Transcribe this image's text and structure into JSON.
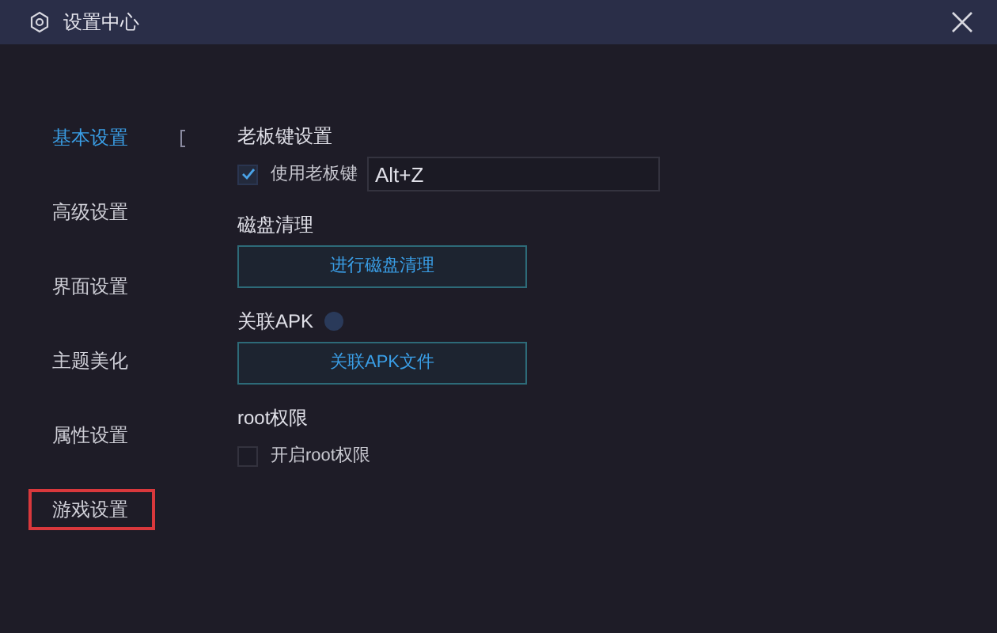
{
  "window": {
    "title": "设置中心"
  },
  "sidebar": {
    "items": [
      {
        "label": "基本设置",
        "selected": true,
        "highlighted": false
      },
      {
        "label": "高级设置",
        "selected": false,
        "highlighted": false
      },
      {
        "label": "界面设置",
        "selected": false,
        "highlighted": false
      },
      {
        "label": "主题美化",
        "selected": false,
        "highlighted": false
      },
      {
        "label": "属性设置",
        "selected": false,
        "highlighted": false
      },
      {
        "label": "游戏设置",
        "selected": false,
        "highlighted": true
      }
    ]
  },
  "sections": [
    {
      "title": "老板键设置",
      "kind": "checkbox-input",
      "checkbox": {
        "label": "使用老板键",
        "checked": true
      },
      "value": "Alt+Z"
    },
    {
      "title": "磁盘清理",
      "kind": "button",
      "button": "进行磁盘清理"
    },
    {
      "title": "关联APK",
      "kind": "button",
      "help": true,
      "button": "关联APK文件"
    },
    {
      "title": "root权限",
      "kind": "checkbox",
      "checkbox": {
        "label": "开启root权限",
        "checked": false
      }
    }
  ]
}
